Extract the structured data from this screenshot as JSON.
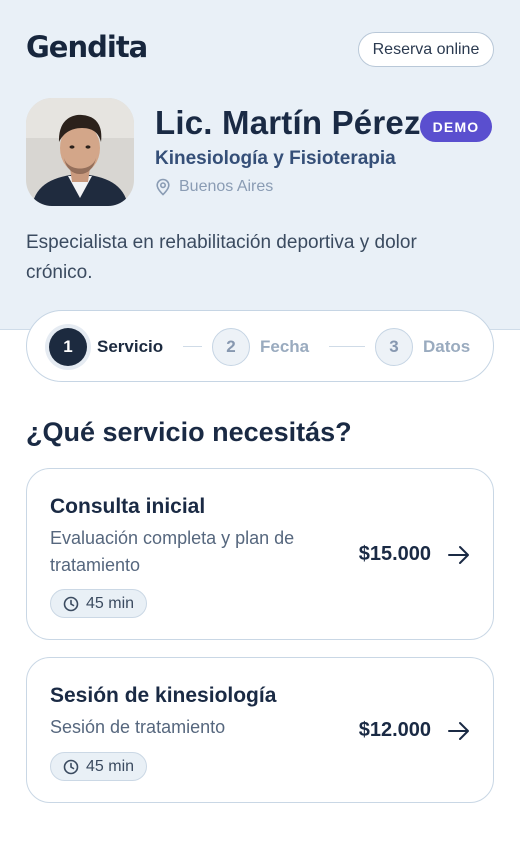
{
  "brand": {
    "logo_text": "Gendita"
  },
  "header": {
    "reserve_label": "Reserva online"
  },
  "profile": {
    "name": "Lic. Martín Pérez",
    "badge": "DEMO",
    "specialty": "Kinesiología y Fisioterapia",
    "location": "Buenos Aires",
    "bio": "Especialista en rehabilitación deportiva y dolor crónico."
  },
  "stepper": {
    "steps": [
      {
        "number": "1",
        "label": "Servicio",
        "state": "active"
      },
      {
        "number": "2",
        "label": "Fecha",
        "state": "idle"
      },
      {
        "number": "3",
        "label": "Datos",
        "state": "idle"
      }
    ]
  },
  "services": {
    "title": "¿Qué servicio necesitás?",
    "items": [
      {
        "name": "Consulta inicial",
        "description": "Evaluación completa y plan de tratamiento",
        "price": "$15.000",
        "duration": "45 min"
      },
      {
        "name": "Sesión de kinesiología",
        "description": "Sesión de tratamiento",
        "price": "$12.000",
        "duration": "45 min"
      }
    ]
  },
  "icons": {
    "location": "map-pin-icon",
    "duration": "clock-icon",
    "select": "arrow-right-icon"
  },
  "colors": {
    "accent": "#5a4fcf",
    "primary": "#1c2a3f",
    "hero_bg": "#e9f0f7"
  }
}
